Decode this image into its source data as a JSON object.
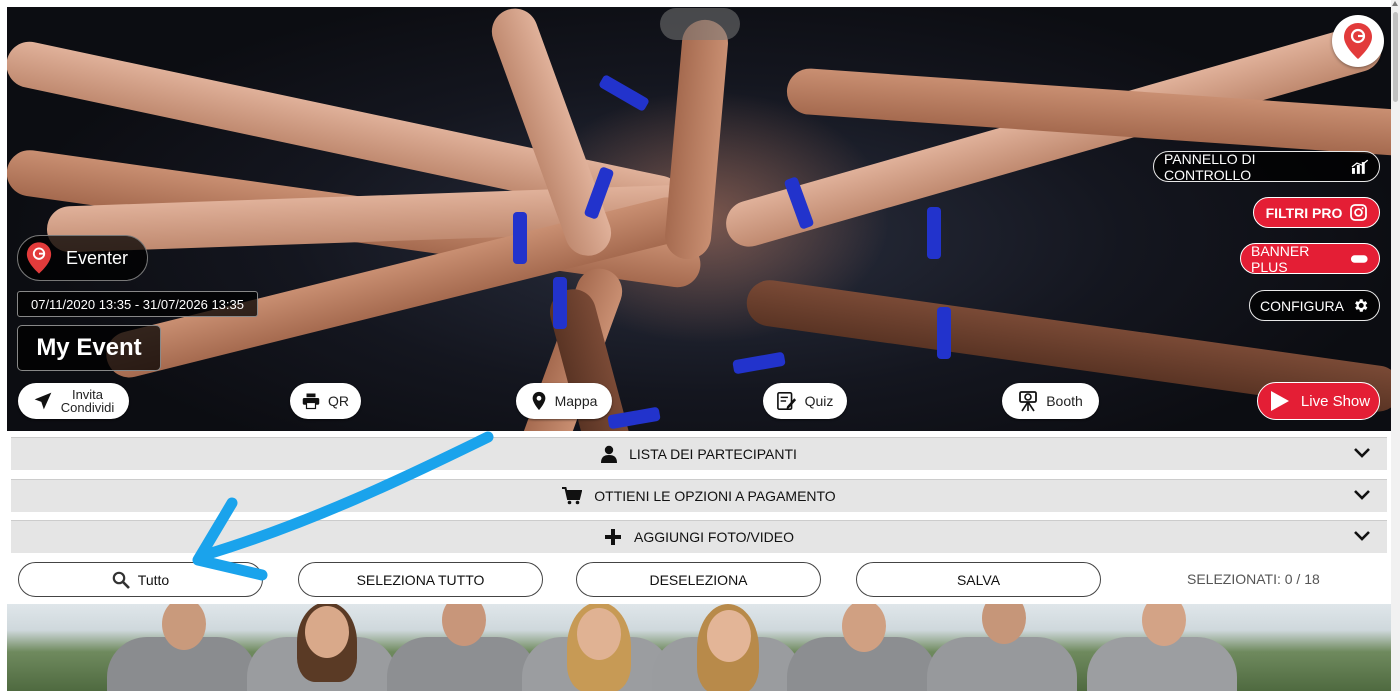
{
  "hero": {
    "brand_name": "Eventer",
    "date_range": "07/11/2020 13:35 - 31/07/2026 13:35",
    "event_title": "My Event"
  },
  "side_buttons": {
    "control_panel": "PANNELLO DI CONTROLLO",
    "filters_pro": "FILTRI PRO",
    "banner_plus": "BANNER PLUS",
    "configure": "CONFIGURA"
  },
  "bottom_actions": {
    "invite_line1": "Invita",
    "invite_line2": "Condividi",
    "qr": "QR",
    "map": "Mappa",
    "quiz": "Quiz",
    "booth": "Booth",
    "live_show": "Live Show"
  },
  "accordion": {
    "participants": "LISTA DEI PARTECIPANTI",
    "paid_options": "OTTIENI LE OPZIONI A PAGAMENTO",
    "add_media": "AGGIUNGI FOTO/VIDEO"
  },
  "toolbar": {
    "filter_all": "Tutto",
    "select_all": "SELEZIONA TUTTO",
    "deselect": "DESELEZIONA",
    "save": "SALVA",
    "selected_count": "SELEZIONATI: 0 / 18"
  },
  "colors": {
    "accent_red": "#e41e35",
    "annotation_arrow": "#1aa3ec"
  }
}
